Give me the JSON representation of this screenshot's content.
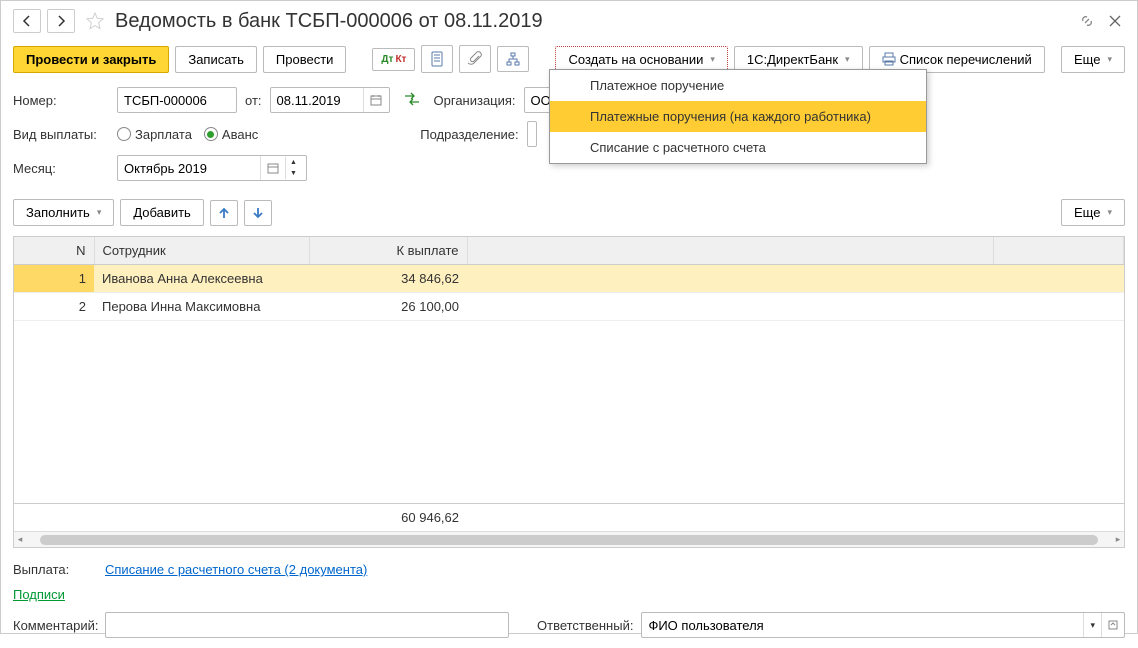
{
  "title": "Ведомость в банк ТСБП-000006 от 08.11.2019",
  "toolbar": {
    "submit_close": "Провести и закрыть",
    "save": "Записать",
    "submit": "Провести",
    "create_based": "Создать на основании",
    "directbank": "1С:ДиректБанк",
    "list": "Список перечислений",
    "more": "Еще"
  },
  "form": {
    "number_label": "Номер:",
    "number_value": "ТСБП-000006",
    "from_label": "от:",
    "date_value": "08.11.2019",
    "org_label": "Организация:",
    "org_value": "ООО",
    "paytype_label": "Вид выплаты:",
    "radio_salary": "Зарплата",
    "radio_advance": "Аванс",
    "division_label": "Подразделение:",
    "month_label": "Месяц:",
    "month_value": "Октябрь 2019"
  },
  "toolbar2": {
    "fill": "Заполнить",
    "add": "Добавить",
    "more": "Еще"
  },
  "table": {
    "columns": {
      "n": "N",
      "employee": "Сотрудник",
      "amount": "К выплате"
    },
    "rows": [
      {
        "n": "1",
        "employee": "Иванова Анна Алексеевна",
        "amount": "34 846,62"
      },
      {
        "n": "2",
        "employee": "Перова Инна Максимовна",
        "amount": "26 100,00"
      }
    ],
    "total": "60 946,62"
  },
  "bottom": {
    "payout_label": "Выплата:",
    "payout_link": "Списание с расчетного счета (2 документа)",
    "signatures": "Подписи",
    "comment_label": "Комментарий:",
    "responsible_label": "Ответственный:",
    "responsible_value": "ФИО пользователя"
  },
  "dropdown": {
    "items": [
      "Платежное поручение",
      "Платежные поручения (на каждого работника)",
      "Списание с расчетного счета"
    ],
    "hover_index": 1
  }
}
